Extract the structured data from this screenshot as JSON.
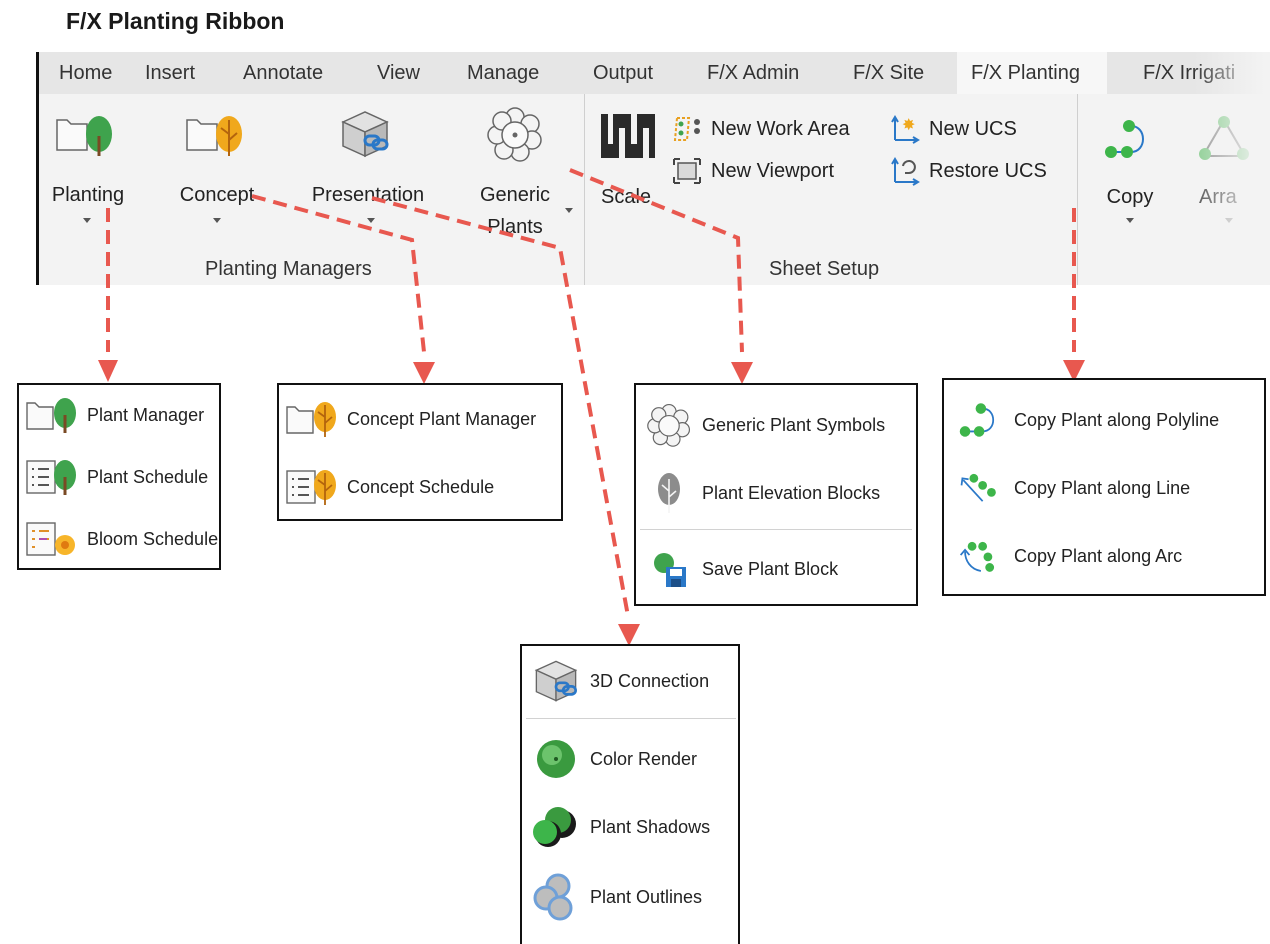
{
  "title": "F/X Planting Ribbon",
  "ribbon": {
    "tabs": [
      "Home",
      "Insert",
      "Annotate",
      "View",
      "Manage",
      "Output",
      "F/X Admin",
      "F/X Site",
      "F/X Planting",
      "F/X Irrigati"
    ],
    "active_tab": "F/X Planting",
    "groups": {
      "planting_managers": {
        "label": "Planting Managers",
        "buttons": {
          "planting": "Planting",
          "concept": "Concept",
          "presentation": "Presentation",
          "generic_line1": "Generic",
          "generic_line2": "Plants"
        }
      },
      "sheet_setup": {
        "label": "Sheet Setup",
        "scale": "Scale",
        "new_work_area": "New Work Area",
        "new_viewport": "New Viewport",
        "new_ucs": "New UCS",
        "restore_ucs": "Restore UCS"
      },
      "edit": {
        "copy": "Copy",
        "array": "Arra"
      }
    }
  },
  "dropdowns": {
    "planting": [
      "Plant Manager",
      "Plant Schedule",
      "Bloom Schedule"
    ],
    "concept": [
      "Concept Plant Manager",
      "Concept Schedule"
    ],
    "generic": [
      "Generic Plant Symbols",
      "Plant Elevation Blocks",
      "Save Plant Block"
    ],
    "copy": [
      "Copy Plant along Polyline",
      "Copy Plant along Line",
      "Copy Plant along Arc"
    ],
    "presentation": [
      "3D Connection",
      "Color Render",
      "Plant Shadows",
      "Plant Outlines"
    ]
  },
  "colors": {
    "connector": "#e8584f",
    "tree_green": "#3fa34d",
    "tree_orange": "#f0a81c",
    "copy_green": "#3db54a",
    "ucs_blue": "#2a78c8"
  }
}
